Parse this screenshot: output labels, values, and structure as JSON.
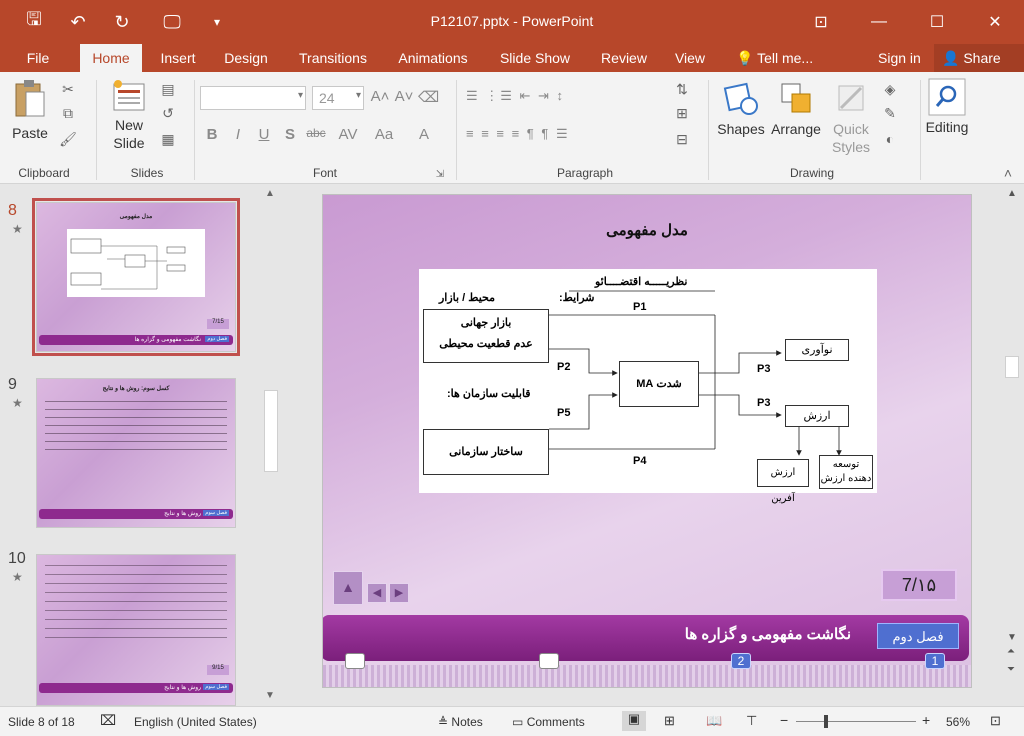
{
  "titlebar": {
    "title": "P12107.pptx - PowerPoint",
    "icons": [
      "save-icon",
      "undo-icon",
      "redo-icon",
      "present-icon",
      "customize-icon"
    ],
    "window_icons": [
      "restore-ribbon-icon",
      "minimize-icon",
      "maximize-icon",
      "close-icon"
    ],
    "glyphs": {
      "save": "🖫",
      "undo": "↶",
      "redo": "↻",
      "present": "🖵",
      "customize": "▾",
      "ribbon": "⊡",
      "minimize": "—",
      "maximize": "☐",
      "close": "✕"
    }
  },
  "tabs": {
    "file": "File",
    "home": "Home",
    "insert": "Insert",
    "design": "Design",
    "transitions": "Transitions",
    "animations": "Animations",
    "slideshow": "Slide Show",
    "review": "Review",
    "view": "View",
    "tellme": "Tell me...",
    "signin": "Sign in",
    "share": "Share"
  },
  "ribbon": {
    "clipboard": {
      "label": "Clipboard",
      "paste": "Paste"
    },
    "slides": {
      "label": "Slides",
      "new_slide": "New",
      "new_slide2": "Slide"
    },
    "font": {
      "label": "Font",
      "size": "24",
      "bold": "B",
      "italic": "I",
      "underline": "U",
      "shadow": "S",
      "strike": "abc",
      "spacing": "AV",
      "case": "Aa",
      "color": "A"
    },
    "paragraph": {
      "label": "Paragraph"
    },
    "drawing": {
      "label": "Drawing",
      "shapes": "Shapes",
      "arrange": "Arrange",
      "quick": "Quick",
      "styles": "Styles"
    },
    "editing": {
      "label": "Editing"
    },
    "accent": "#b7472a"
  },
  "thumbnails": [
    {
      "num": "8",
      "star": "★",
      "title": "مدل مفهومی",
      "page": "7/15",
      "footer": "نگاشت مفهومی و گزاره ها",
      "chapter": "فصل دوم"
    },
    {
      "num": "9",
      "star": "★",
      "title": "کسل سوم: روش ها و نتایج",
      "footer": "روش ها و نتایج",
      "chapter": "فصل سوم"
    },
    {
      "num": "10",
      "star": "★",
      "footer": "روش ها و نتایج",
      "chapter": "فصل سوم",
      "page": "9/15"
    }
  ],
  "slide": {
    "title": "مدل مفهومی",
    "page": "7/۱۵",
    "footer_title": "نگاشت مفهومی و گزاره ها",
    "chapter": "فصل دوم",
    "dot_numbers": [
      "2",
      "1"
    ],
    "diagram": {
      "theory": "نظریـــــه اقتضــــائو",
      "conditions": "شرایط:",
      "environment": "محیط / بازار",
      "global_market": "بازار جهانی",
      "uncertainty": "عدم قطعیت محیطی",
      "capabilities": "قابلیت سازمان ها:",
      "structure": "ساختار سازمانی",
      "center": "شدت  MA",
      "innovation": "نوآوری",
      "value": "ارزش",
      "value_creator": "ارزش آفرین",
      "value_developer": "توسعه دهنده ارزش",
      "p1": "P1",
      "p2": "P2",
      "p3a": "P3",
      "p3b": "P3",
      "p4": "P4",
      "p5": "P5"
    }
  },
  "statusbar": {
    "slide_of": "Slide 8 of 18",
    "language": "English (United States)",
    "notes": "Notes",
    "comments": "Comments",
    "zoom": "56%",
    "minus": "−",
    "plus": "+"
  }
}
